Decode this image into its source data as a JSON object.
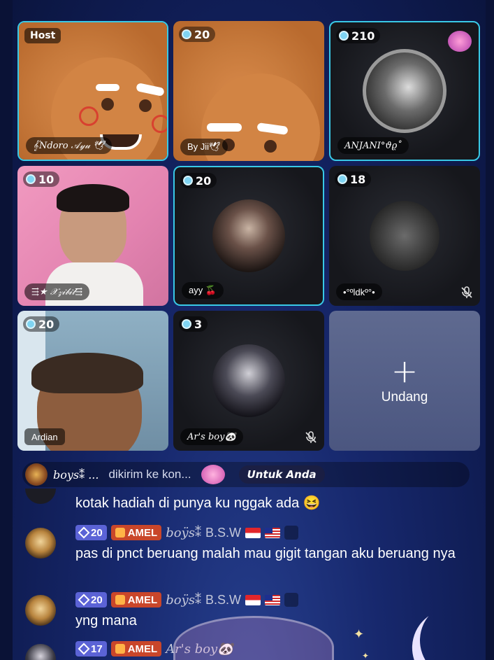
{
  "tiles": [
    {
      "badge": "Host",
      "name": "𝄟Ndoro 𝒜𝓎𝓊 🕊"
    },
    {
      "count": "20",
      "name": "By Jii🕊"
    },
    {
      "count": "210",
      "name": "ANJANI°ϑϱ˚"
    },
    {
      "count": "10",
      "name": "⇶★ 𝒳𝓏𝒾𝒷𝒾𝓉⇶"
    },
    {
      "count": "20",
      "name": "ayy 🍒"
    },
    {
      "count": "18",
      "name": "•°ºldkº°•"
    },
    {
      "count": "20",
      "name": "Ardian"
    },
    {
      "count": "3",
      "name": "Ar's boy🐼"
    }
  ],
  "invite": {
    "plus": "+",
    "label": "Undang"
  },
  "notice": {
    "sender": "boys⁑ ...",
    "message": "dikirim ke kon...",
    "for_label": "Untuk Anda"
  },
  "chat": [
    {
      "text": "kotak hadiah di punya ku nggak ada 😆"
    },
    {
      "level": "20",
      "club": "AMEL",
      "user": "boÿs⁑",
      "user2": "B.S.W",
      "text": "pas di pnct beruang malah mau gigit tangan aku beruang nya"
    },
    {
      "level": "20",
      "club": "AMEL",
      "user": "boÿs⁑",
      "user2": "B.S.W",
      "text": "yng mana"
    },
    {
      "level": "17",
      "club": "AMEL",
      "user": "Ar's boy🐼"
    }
  ],
  "colors": {
    "active_border": "#39c9e6",
    "level_badge": "#5b63d6",
    "club_badge": "#c9462a"
  },
  "icons": [
    "mic-off-icon",
    "plus-icon",
    "diamond-icon",
    "heart-icon",
    "people-icon"
  ]
}
